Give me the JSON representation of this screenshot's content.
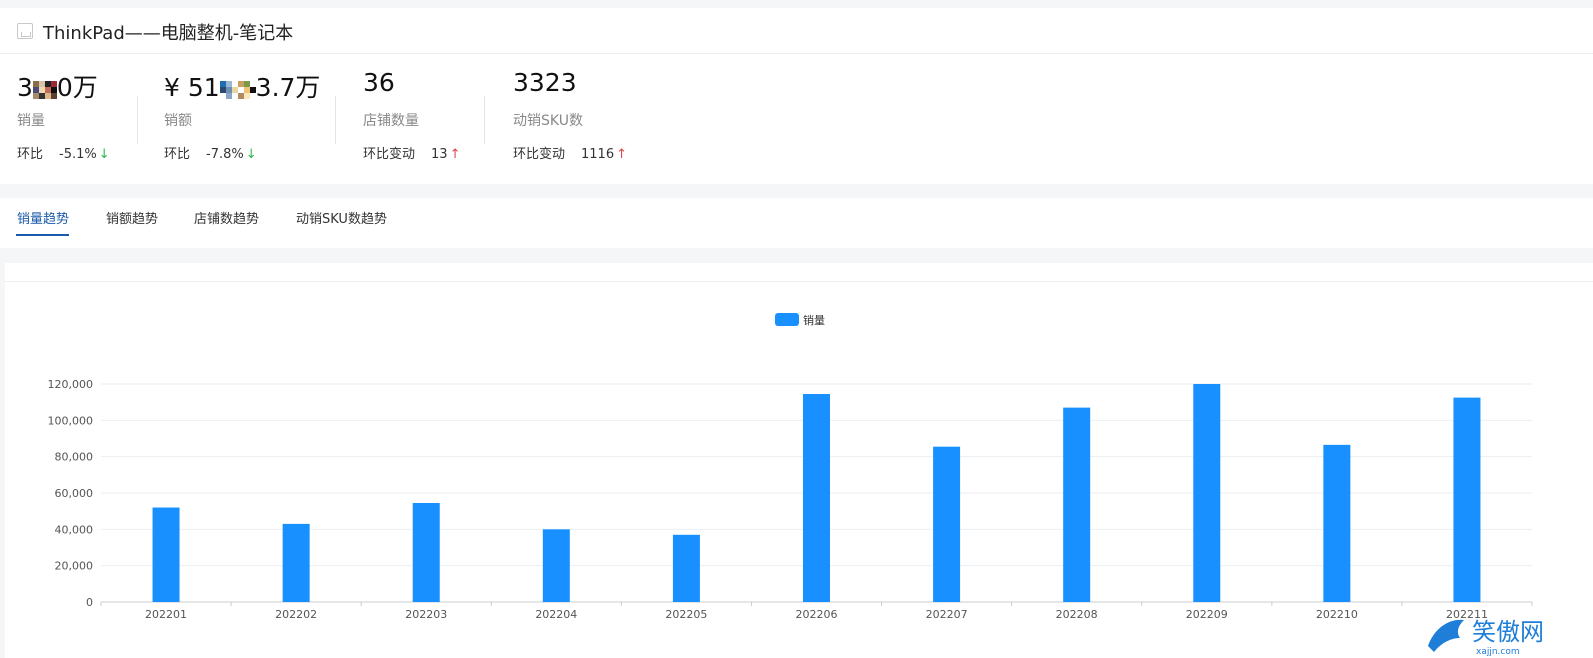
{
  "header": {
    "title": "ThinkPad——电脑整机-笔记本"
  },
  "stats": [
    {
      "value_prefix": "3",
      "value_suffix": "0万",
      "label": "销量",
      "change_label": "环比",
      "change_value": "-5.1%",
      "direction": "down"
    },
    {
      "value_prefix": "¥ 51",
      "value_suffix": "3.7万",
      "label": "销额",
      "change_label": "环比",
      "change_value": "-7.8%",
      "direction": "down"
    },
    {
      "value_prefix": "36",
      "value_suffix": "",
      "label": "店铺数量",
      "change_label": "环比变动",
      "change_value": "13",
      "direction": "up"
    },
    {
      "value_prefix": "3323",
      "value_suffix": "",
      "label": "动销SKU数",
      "change_label": "环比变动",
      "change_value": "1116",
      "direction": "up"
    }
  ],
  "tabs": [
    {
      "label": "销量趋势",
      "active": true
    },
    {
      "label": "销额趋势",
      "active": false
    },
    {
      "label": "店铺数趋势",
      "active": false
    },
    {
      "label": "动销SKU数趋势",
      "active": false
    }
  ],
  "arrows": {
    "up": "↑",
    "down": "↓"
  },
  "colors": {
    "bar": "#1890ff",
    "active_tab": "#1a5aa8",
    "up": "#e0454a",
    "down": "#2fb34c"
  },
  "watermark": {
    "text": "笑傲网",
    "subtext": "xajjn.com"
  },
  "chart_data": {
    "type": "bar",
    "categories": [
      "202201",
      "202202",
      "202203",
      "202204",
      "202205",
      "202206",
      "202207",
      "202208",
      "202209",
      "202210",
      "202211"
    ],
    "series": [
      {
        "name": "销量",
        "values": [
          52000,
          43000,
          54500,
          40000,
          37000,
          114500,
          85500,
          107000,
          120000,
          86500,
          112500
        ]
      }
    ],
    "ylim": [
      0,
      120000
    ],
    "yticks": [
      "0",
      "20,000",
      "40,000",
      "60,000",
      "80,000",
      "100,000",
      "120,000"
    ],
    "legend_position": "top-center",
    "grid": true
  }
}
